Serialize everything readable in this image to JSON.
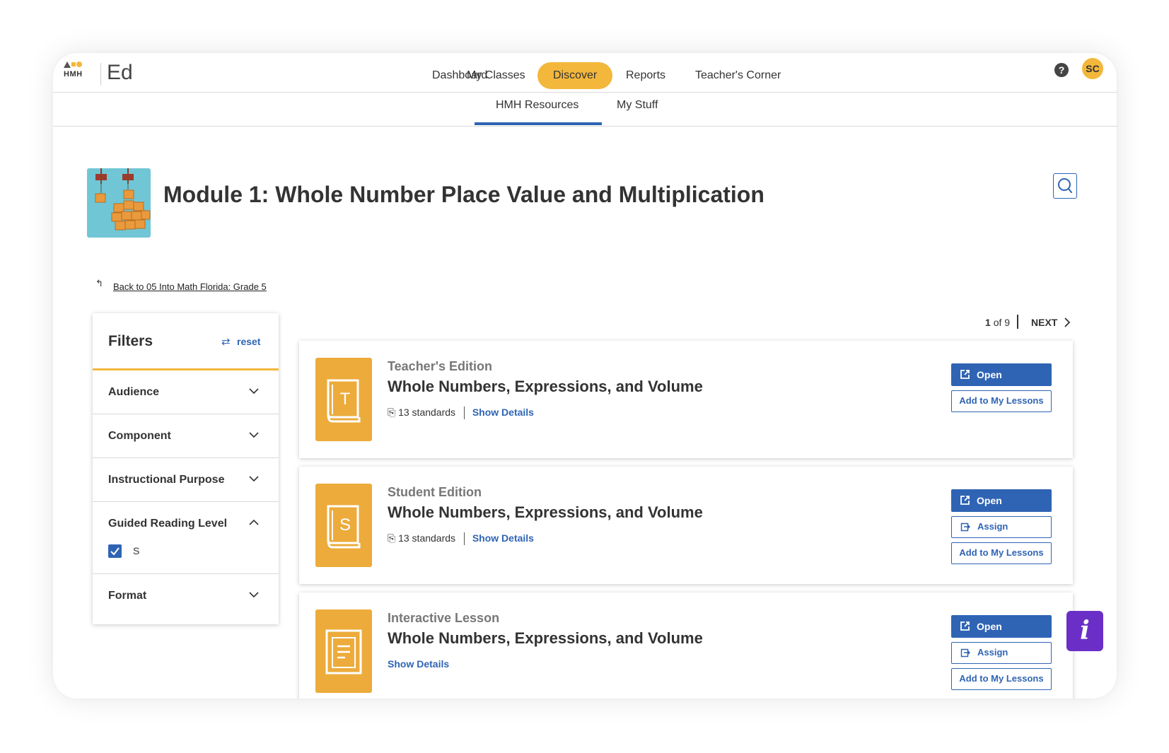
{
  "app": {
    "logo_text": "HMH",
    "brand": "Ed"
  },
  "nav": {
    "items": [
      {
        "label": "Dashboard",
        "active": false
      },
      {
        "label": "My Classes",
        "active": false
      },
      {
        "label": "Discover",
        "active": true
      },
      {
        "label": "Reports",
        "active": false
      },
      {
        "label": "Teacher's Corner",
        "active": false
      }
    ],
    "help_glyph": "?",
    "user_initials": "SC"
  },
  "subnav": {
    "tabs": [
      {
        "label": "HMH Resources",
        "active": true
      },
      {
        "label": "My Stuff",
        "active": false
      }
    ]
  },
  "module": {
    "title": "Module 1: Whole Number Place Value and Multiplication"
  },
  "back_link": "Back to 05 Into Math Florida: Grade 5",
  "filters": {
    "title": "Filters",
    "reset_label": "reset",
    "facets": [
      {
        "label": "Audience",
        "expanded": false
      },
      {
        "label": "Component",
        "expanded": false
      },
      {
        "label": "Instructional Purpose",
        "expanded": false
      },
      {
        "label": "Guided Reading Level",
        "expanded": true,
        "options": [
          {
            "label": "S",
            "checked": true
          }
        ]
      },
      {
        "label": "Format",
        "expanded": false
      }
    ]
  },
  "pager": {
    "current": "1",
    "of_text": "of 9",
    "next_label": "NEXT"
  },
  "cards": [
    {
      "type": "Teacher's Edition",
      "icon_letter": "T",
      "title": "Whole Numbers, Expressions, and Volume",
      "standards": "13 standards",
      "show_details": "Show Details",
      "open_label": "Open",
      "add_label": "Add to My Lessons"
    },
    {
      "type": "Student Edition",
      "icon_letter": "S",
      "title": "Whole Numbers, Expressions, and Volume",
      "standards": "13 standards",
      "show_details": "Show Details",
      "open_label": "Open",
      "assign_label": "Assign",
      "add_label": "Add to My Lessons"
    },
    {
      "type": "Interactive Lesson",
      "title": "Whole Numbers, Expressions, and Volume",
      "show_details": "Show Details",
      "open_label": "Open",
      "assign_label": "Assign",
      "add_label": "Add to My Lessons"
    }
  ],
  "info_badge": "i",
  "colors": {
    "accent_yellow": "#f3b73b",
    "brand_blue": "#2f64b4",
    "card_icon_orange": "#ecab3b",
    "info_purple": "#6b2fc7"
  }
}
